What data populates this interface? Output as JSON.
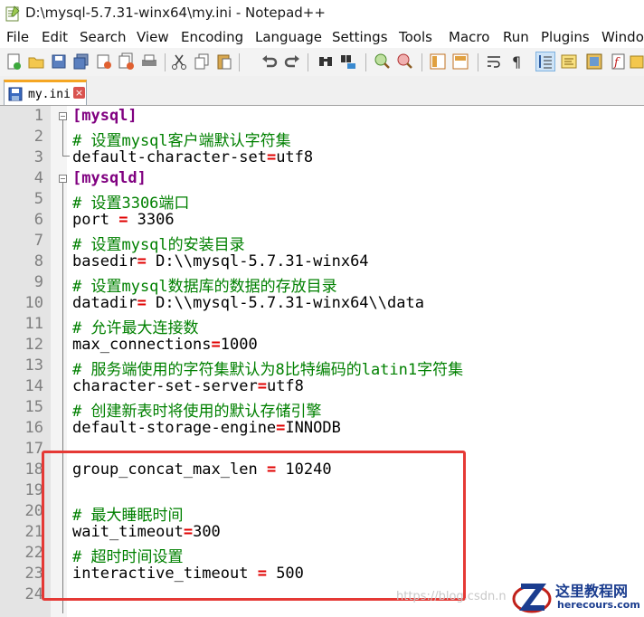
{
  "window": {
    "title": "D:\\mysql-5.7.31-winx64\\my.ini - Notepad++"
  },
  "menu": [
    "File",
    "Edit",
    "Search",
    "View",
    "Encoding",
    "Language",
    "Settings",
    "Tools",
    "Macro",
    "Run",
    "Plugins",
    "Windo"
  ],
  "toolbar": [
    "new-file-icon",
    "open-file-icon",
    "save-icon",
    "save-all-icon",
    "close-icon",
    "close-all-icon",
    "print-icon",
    "cut-icon",
    "copy-icon",
    "paste-icon",
    "undo-icon",
    "redo-icon",
    "find-icon",
    "replace-icon",
    "zoom-in-icon",
    "zoom-out-icon",
    "sync-vertical-icon",
    "sync-horizontal-icon",
    "word-wrap-icon",
    "show-all-chars-icon",
    "indent-guide-icon",
    "doc-map-icon",
    "function-list-icon",
    "record-macro-icon",
    "folder-workspace-icon"
  ],
  "tab": {
    "label": "my.ini",
    "close": "×"
  },
  "lines": [
    {
      "n": "1",
      "tokens": [
        {
          "t": "[mysql]",
          "c": "sec"
        }
      ]
    },
    {
      "n": "2",
      "tokens": [
        {
          "t": "# 设置mysql客户端默认字符集",
          "c": "cmt"
        }
      ]
    },
    {
      "n": "3",
      "tokens": [
        {
          "t": "default-character-set",
          "c": ""
        },
        {
          "t": "=",
          "c": "eq"
        },
        {
          "t": "utf8",
          "c": ""
        }
      ]
    },
    {
      "n": "4",
      "tokens": [
        {
          "t": "[mysqld]",
          "c": "sec"
        }
      ]
    },
    {
      "n": "5",
      "tokens": [
        {
          "t": "# 设置3306端口",
          "c": "cmt"
        }
      ]
    },
    {
      "n": "6",
      "tokens": [
        {
          "t": "port ",
          "c": ""
        },
        {
          "t": "=",
          "c": "eq"
        },
        {
          "t": " 3306",
          "c": ""
        }
      ]
    },
    {
      "n": "7",
      "tokens": [
        {
          "t": "# 设置mysql的安装目录",
          "c": "cmt"
        }
      ]
    },
    {
      "n": "8",
      "tokens": [
        {
          "t": "basedir",
          "c": ""
        },
        {
          "t": "=",
          "c": "eq"
        },
        {
          "t": " D:\\\\mysql-5.7.31-winx64",
          "c": ""
        }
      ]
    },
    {
      "n": "9",
      "tokens": [
        {
          "t": "# 设置mysql数据库的数据的存放目录",
          "c": "cmt"
        }
      ]
    },
    {
      "n": "10",
      "tokens": [
        {
          "t": "datadir",
          "c": ""
        },
        {
          "t": "=",
          "c": "eq"
        },
        {
          "t": " D:\\\\mysql-5.7.31-winx64\\\\data",
          "c": ""
        }
      ]
    },
    {
      "n": "11",
      "tokens": [
        {
          "t": "# 允许最大连接数",
          "c": "cmt"
        }
      ]
    },
    {
      "n": "12",
      "tokens": [
        {
          "t": "max_connections",
          "c": ""
        },
        {
          "t": "=",
          "c": "eq"
        },
        {
          "t": "1000",
          "c": ""
        }
      ]
    },
    {
      "n": "13",
      "tokens": [
        {
          "t": "# 服务端使用的字符集默认为8比特编码的latin1字符集",
          "c": "cmt"
        }
      ]
    },
    {
      "n": "14",
      "tokens": [
        {
          "t": "character-set-server",
          "c": ""
        },
        {
          "t": "=",
          "c": "eq"
        },
        {
          "t": "utf8",
          "c": ""
        }
      ]
    },
    {
      "n": "15",
      "tokens": [
        {
          "t": "# 创建新表时将使用的默认存储引擎",
          "c": "cmt"
        }
      ]
    },
    {
      "n": "16",
      "tokens": [
        {
          "t": "default-storage-engine",
          "c": ""
        },
        {
          "t": "=",
          "c": "eq"
        },
        {
          "t": "INNODB",
          "c": ""
        }
      ]
    },
    {
      "n": "17",
      "tokens": []
    },
    {
      "n": "18",
      "tokens": [
        {
          "t": "group_concat_max_len ",
          "c": ""
        },
        {
          "t": "=",
          "c": "eq"
        },
        {
          "t": " 10240",
          "c": ""
        }
      ]
    },
    {
      "n": "19",
      "tokens": []
    },
    {
      "n": "20",
      "tokens": [
        {
          "t": "# 最大睡眠时间",
          "c": "cmt"
        }
      ]
    },
    {
      "n": "21",
      "tokens": [
        {
          "t": "wait_timeout",
          "c": ""
        },
        {
          "t": "=",
          "c": "eq"
        },
        {
          "t": "300",
          "c": ""
        }
      ]
    },
    {
      "n": "22",
      "tokens": [
        {
          "t": "# 超时时间设置",
          "c": "cmt"
        }
      ]
    },
    {
      "n": "23",
      "tokens": [
        {
          "t": "interactive_timeout ",
          "c": ""
        },
        {
          "t": "=",
          "c": "eq"
        },
        {
          "t": " 500",
          "c": ""
        }
      ]
    },
    {
      "n": "24",
      "tokens": []
    }
  ],
  "watermark": {
    "url": "https://blog.csdn.n"
  },
  "site_logo": {
    "name": "这里教程网",
    "domain": "herecours.com"
  },
  "colors": {
    "section": "#800080",
    "comment": "#008000",
    "operator": "#e00000",
    "highlight": "#e53935"
  }
}
